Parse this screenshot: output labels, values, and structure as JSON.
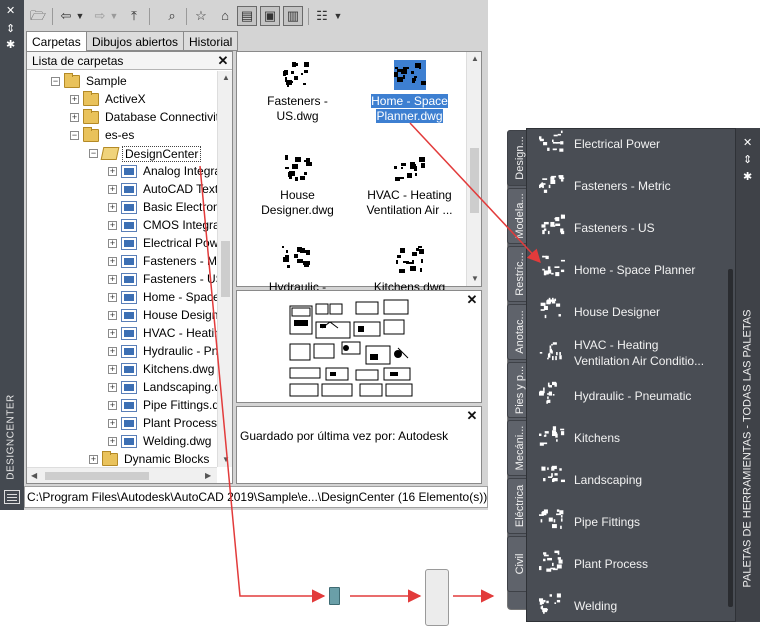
{
  "designcenter": {
    "vertical_title": "DESIGNCENTER",
    "tabs": [
      "Carpetas",
      "Dibujos abiertos",
      "Historial"
    ],
    "folder_list_title": "Lista de carpetas",
    "tree": [
      {
        "label": "Sample",
        "indent": 1,
        "icon": "folder",
        "exp": "−"
      },
      {
        "label": "ActiveX",
        "indent": 2,
        "icon": "folder",
        "exp": "+"
      },
      {
        "label": "Database Connectivity",
        "indent": 2,
        "icon": "folder",
        "exp": "+"
      },
      {
        "label": "es-es",
        "indent": 2,
        "icon": "folder",
        "exp": "−"
      },
      {
        "label": "DesignCenter",
        "indent": 3,
        "icon": "folderopen",
        "exp": "−",
        "selected": true
      },
      {
        "label": "Analog Integra",
        "indent": 4,
        "icon": "dwg",
        "exp": "+"
      },
      {
        "label": "AutoCAD Texts",
        "indent": 4,
        "icon": "dwg",
        "exp": "+"
      },
      {
        "label": "Basic Electroni",
        "indent": 4,
        "icon": "dwg",
        "exp": "+"
      },
      {
        "label": "CMOS Integrat",
        "indent": 4,
        "icon": "dwg",
        "exp": "+"
      },
      {
        "label": "Electrical Powe",
        "indent": 4,
        "icon": "dwg",
        "exp": "+"
      },
      {
        "label": "Fasteners - Met",
        "indent": 4,
        "icon": "dwg",
        "exp": "+"
      },
      {
        "label": "Fasteners - US.",
        "indent": 4,
        "icon": "dwg",
        "exp": "+"
      },
      {
        "label": "Home - Space",
        "indent": 4,
        "icon": "dwg",
        "exp": "+"
      },
      {
        "label": "House Designe",
        "indent": 4,
        "icon": "dwg",
        "exp": "+"
      },
      {
        "label": "HVAC - Heatin",
        "indent": 4,
        "icon": "dwg",
        "exp": "+"
      },
      {
        "label": "Hydraulic - Pne",
        "indent": 4,
        "icon": "dwg",
        "exp": "+"
      },
      {
        "label": "Kitchens.dwg",
        "indent": 4,
        "icon": "dwg",
        "exp": "+"
      },
      {
        "label": "Landscaping.d",
        "indent": 4,
        "icon": "dwg",
        "exp": "+"
      },
      {
        "label": "Pipe Fittings.d",
        "indent": 4,
        "icon": "dwg",
        "exp": "+"
      },
      {
        "label": "Plant Process.d",
        "indent": 4,
        "icon": "dwg",
        "exp": "+"
      },
      {
        "label": "Welding.dwg",
        "indent": 4,
        "icon": "dwg",
        "exp": "+"
      },
      {
        "label": "Dynamic Blocks",
        "indent": 3,
        "icon": "folder",
        "exp": "+"
      }
    ],
    "content_items": [
      {
        "line1": "Fasteners -",
        "line2": "US.dwg"
      },
      {
        "line1": "Home - Space",
        "line2": "Planner.dwg",
        "selected": true
      },
      {
        "line1": "House",
        "line2": "Designer.dwg"
      },
      {
        "line1": "HVAC - Heating",
        "line2": "Ventilation Air ..."
      },
      {
        "line1": "Hydraulic -",
        "line2": ""
      },
      {
        "line1": "Kitchens.dwg",
        "line2": ""
      }
    ],
    "description": "Guardado por última vez por: Autodesk",
    "status_path": "C:\\Program Files\\Autodesk\\AutoCAD 2019\\Sample\\e...\\DesignCenter (16 Elemento(s))"
  },
  "tool_palettes": {
    "vertical_title": "PALETAS DE HERRAMIENTAS - TODAS LAS PALETAS",
    "side_tabs": [
      "Design...",
      "Modela...",
      "Restric...",
      "Anotac...",
      "Pies y p...",
      "Mecáni...",
      "Eléctrica",
      "Civil"
    ],
    "tools": [
      {
        "line1": "Electrical Power",
        "line2": ""
      },
      {
        "line1": "Fasteners - Metric",
        "line2": ""
      },
      {
        "line1": "Fasteners - US",
        "line2": ""
      },
      {
        "line1": "Home - Space Planner",
        "line2": ""
      },
      {
        "line1": "House Designer",
        "line2": ""
      },
      {
        "line1": "HVAC - Heating",
        "line2": "Ventilation Air Conditio..."
      },
      {
        "line1": "Hydraulic - Pneumatic",
        "line2": ""
      },
      {
        "line1": "Kitchens",
        "line2": ""
      },
      {
        "line1": "Landscaping",
        "line2": ""
      },
      {
        "line1": "Pipe Fittings",
        "line2": ""
      },
      {
        "line1": "Plant Process",
        "line2": ""
      },
      {
        "line1": "Welding",
        "line2": ""
      }
    ]
  },
  "colors": {
    "arrow": "#e23b3b",
    "selection": "#3d7fd1",
    "palette_bg": "#494d54"
  }
}
